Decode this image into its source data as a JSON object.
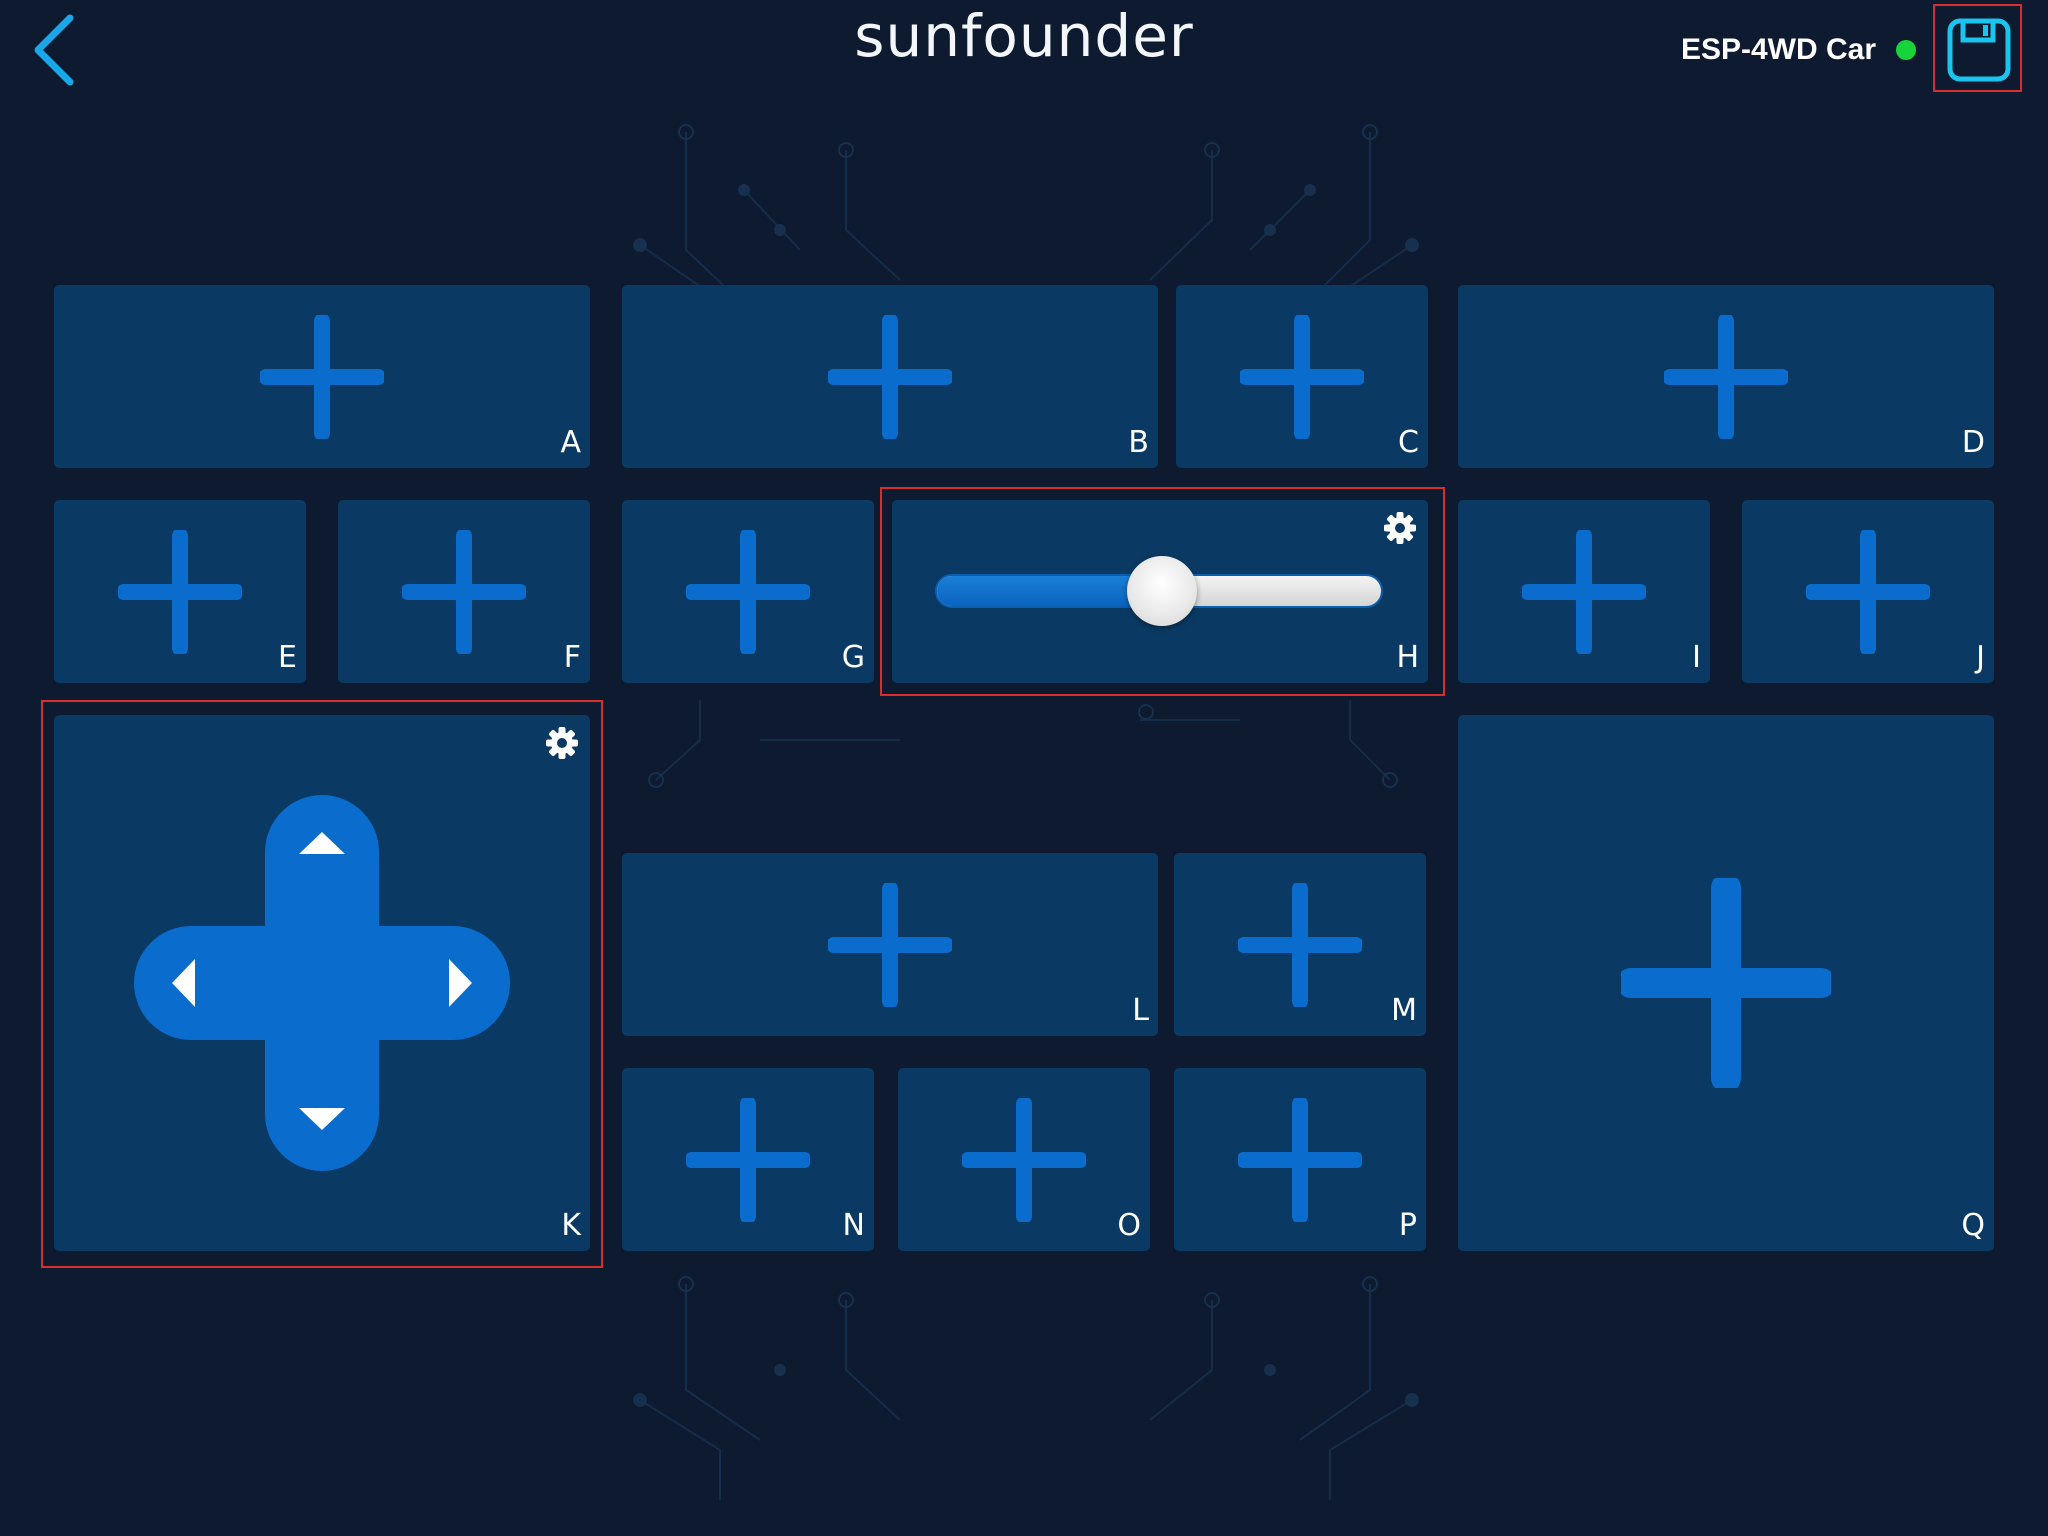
{
  "header": {
    "title": "sunfounder",
    "device_name": "ESP-4WD Car"
  },
  "colors": {
    "background": "#0e1a2f",
    "slot_fill": "#0a3a63",
    "accent_blue": "#0a6ccc",
    "highlight_red": "#d82d2d",
    "status_online": "#18d43a",
    "back_icon": "#1aa7e8",
    "save_icon": "#1bc4ee"
  },
  "icons": {
    "back": "chevron-left-icon",
    "save": "floppy-disk-icon",
    "add": "plus-icon",
    "settings": "gear-icon"
  },
  "slots": {
    "A": "A",
    "B": "B",
    "C": "C",
    "D": "D",
    "E": "E",
    "F": "F",
    "G": "G",
    "H": "H",
    "I": "I",
    "J": "J",
    "K": "K",
    "L": "L",
    "M": "M",
    "N": "N",
    "O": "O",
    "P": "P",
    "Q": "Q"
  },
  "widgets": {
    "H": {
      "type": "slider",
      "value": 0.5
    },
    "K": {
      "type": "d-pad"
    }
  }
}
